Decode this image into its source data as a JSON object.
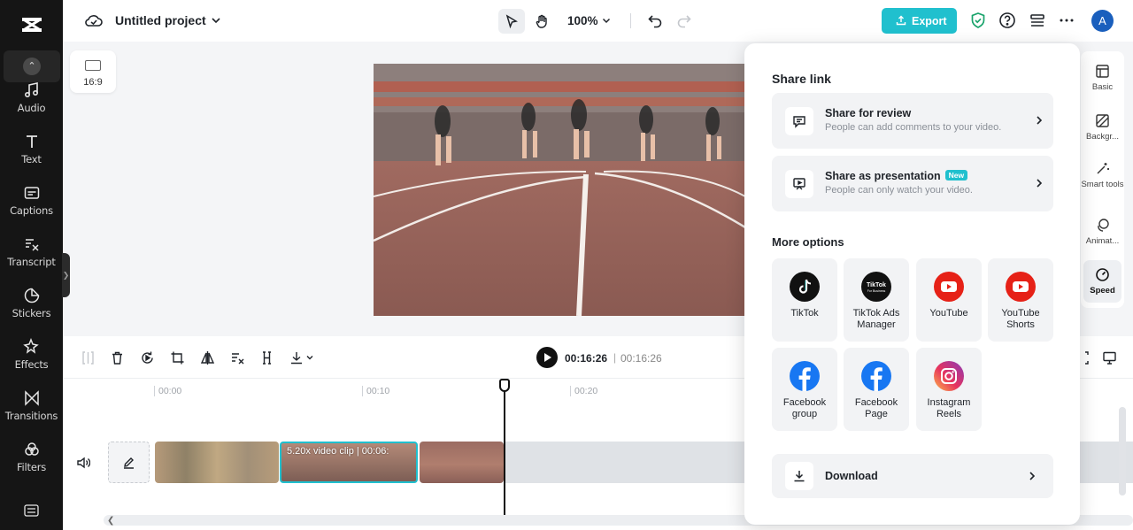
{
  "app": {
    "project_title": "Untitled project",
    "zoom": "100%",
    "export_label": "Export",
    "avatar_initial": "A"
  },
  "sidebar": {
    "items": [
      {
        "label": "Audio",
        "icon": "music-note-icon"
      },
      {
        "label": "Text",
        "icon": "text-icon"
      },
      {
        "label": "Captions",
        "icon": "captions-icon"
      },
      {
        "label": "Transcript",
        "icon": "transcript-icon"
      },
      {
        "label": "Stickers",
        "icon": "sticker-icon"
      },
      {
        "label": "Effects",
        "icon": "effects-icon"
      },
      {
        "label": "Transitions",
        "icon": "transition-icon"
      },
      {
        "label": "Filters",
        "icon": "filters-icon"
      }
    ]
  },
  "canvas": {
    "aspect_ratio": "16:9"
  },
  "right_tools": {
    "items": [
      {
        "label": "Basic"
      },
      {
        "label": "Backgr..."
      },
      {
        "label": "Smart tools"
      },
      {
        "label": "Animat..."
      },
      {
        "label": "Speed"
      }
    ]
  },
  "timeline": {
    "current_time": "00:16:26",
    "separator": "|",
    "total_time": "00:16:26",
    "ruler": [
      "00:00",
      "00:10",
      "00:20"
    ],
    "selected_clip_label": "5.20x  video clip | 00:06:"
  },
  "share": {
    "share_link_heading": "Share link",
    "review": {
      "title": "Share for review",
      "desc": "People can add comments to your video."
    },
    "presentation": {
      "title": "Share as presentation",
      "badge": "New",
      "desc": "People can only watch your video."
    },
    "more_heading": "More options",
    "options": [
      {
        "label": "TikTok"
      },
      {
        "label": "TikTok Ads Manager",
        "logo_text": "TikTok",
        "logo_sub": "For Business"
      },
      {
        "label": "YouTube"
      },
      {
        "label": "YouTube Shorts"
      },
      {
        "label": "Facebook group"
      },
      {
        "label": "Facebook Page"
      },
      {
        "label": "Instagram Reels"
      }
    ],
    "download_label": "Download"
  },
  "colors": {
    "accent": "#20c0ce",
    "youtube": "#e62117",
    "facebook": "#1877f2",
    "avatar": "#1a5fbd"
  }
}
